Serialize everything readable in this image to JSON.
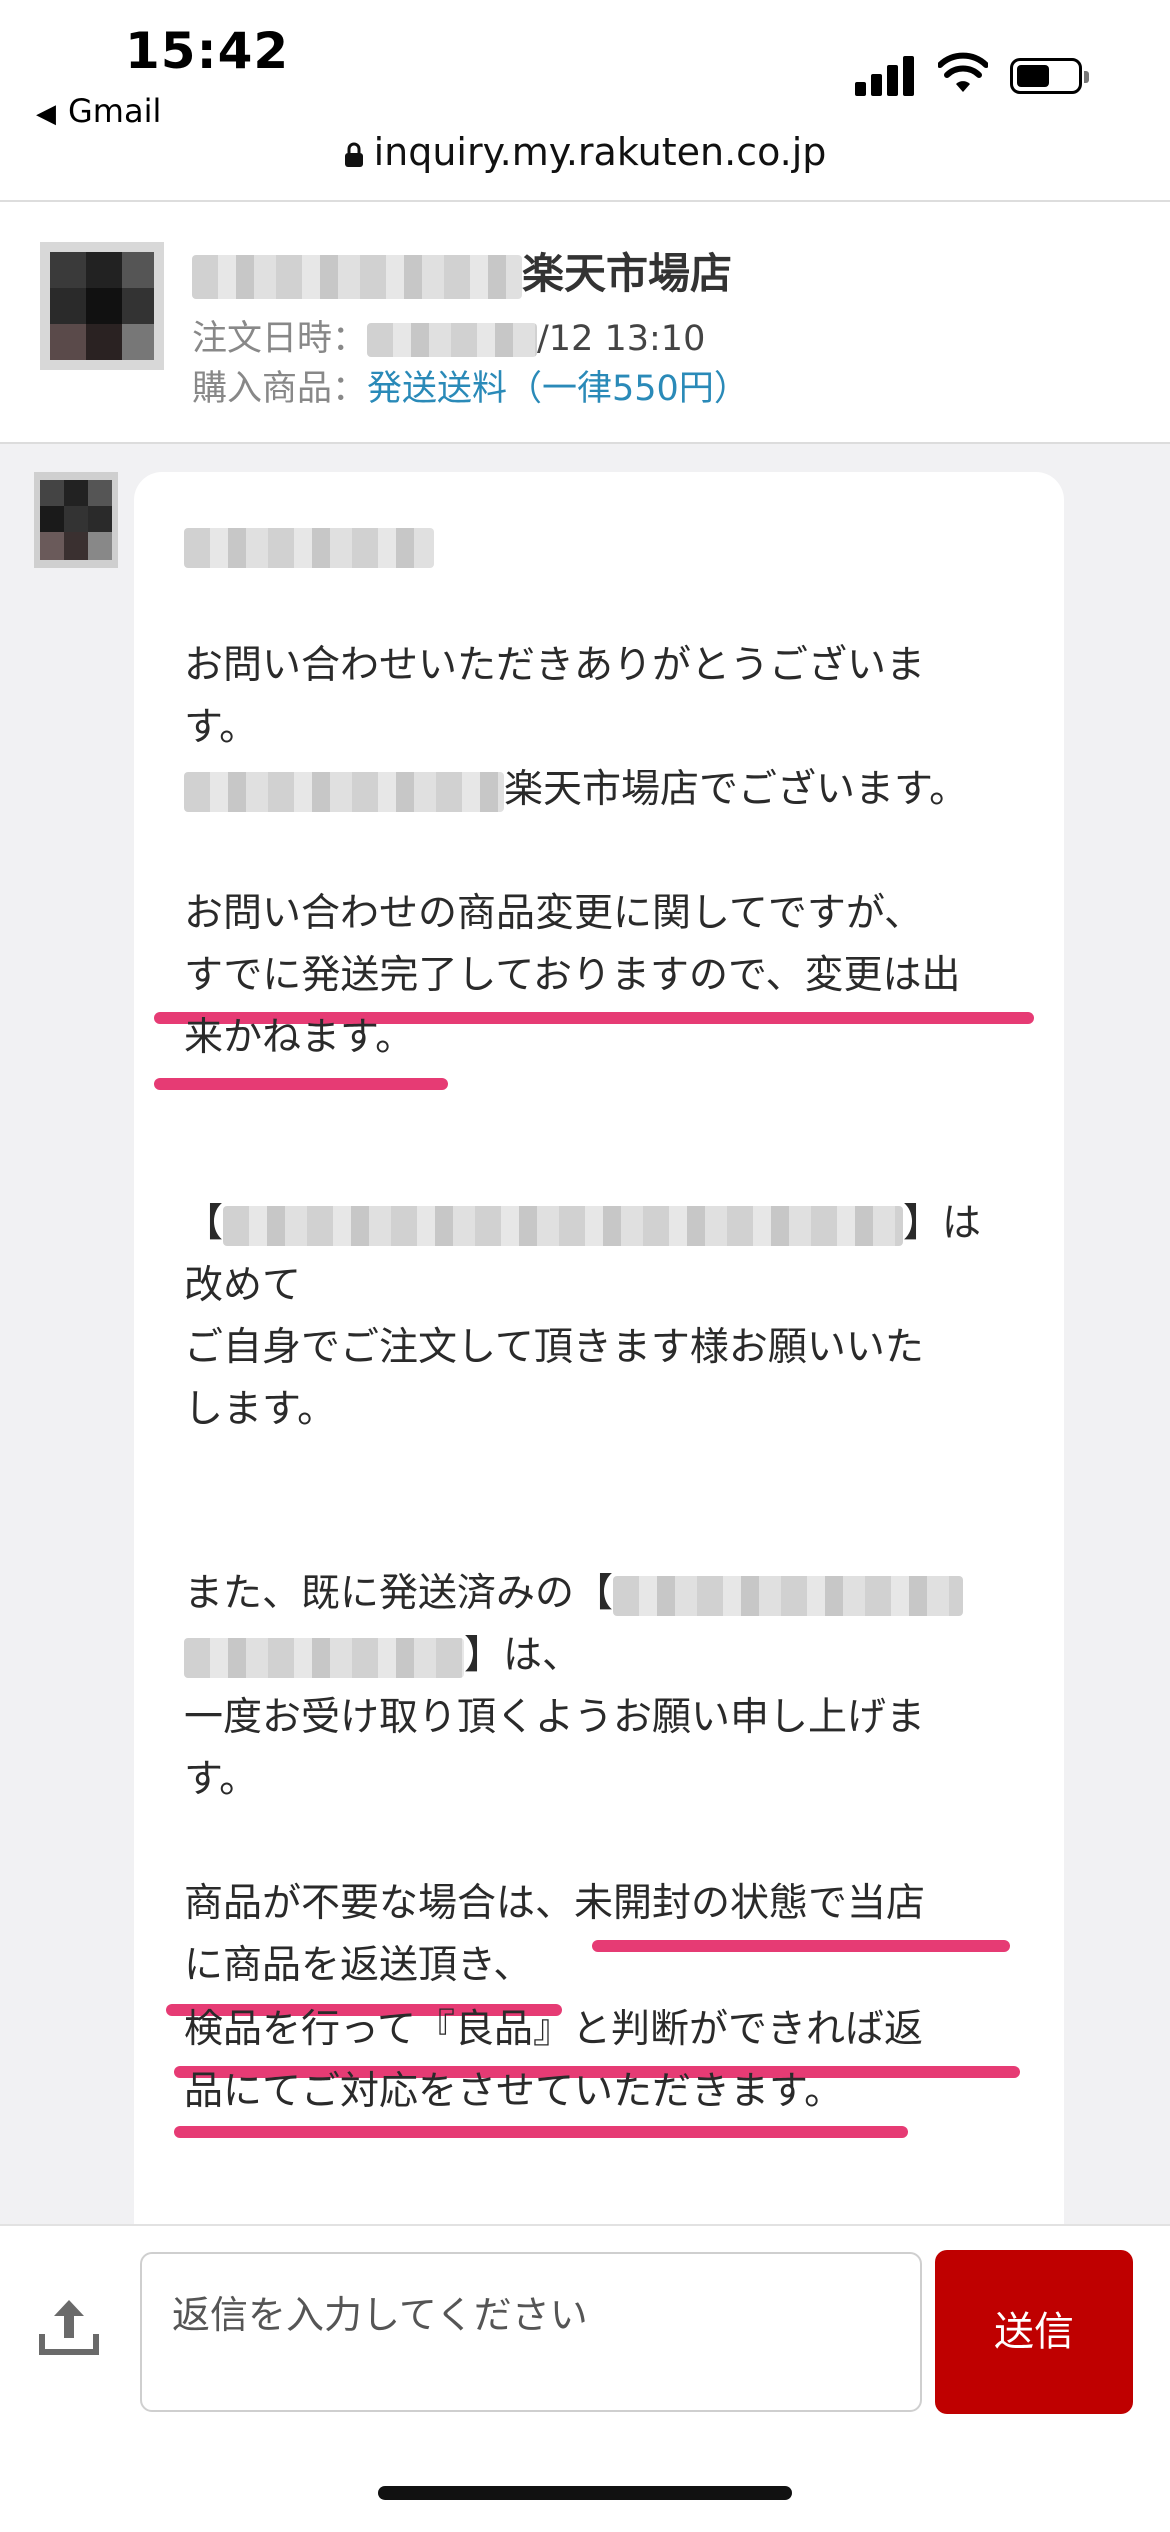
{
  "status_bar": {
    "time": "15:42",
    "back_app": "Gmail"
  },
  "browser": {
    "url": "inquiry.my.rakuten.co.jp"
  },
  "shop": {
    "name_suffix": "楽天市場店",
    "order_date_label": "注文日時：",
    "order_date_value": "/12 13:10",
    "product_label": "購入商品：",
    "product_value": "発送送料（一律550円）"
  },
  "message": {
    "line1": "お問い合わせいただきありがとうございま",
    "line2": "す。",
    "line3": "楽天市場店でございます。",
    "line4": "お問い合わせの商品変更に関してですが、",
    "line5": "すでに発送完了しておりますので、変更は出",
    "line6": "来かねます。",
    "line7_open": "【",
    "line7_close": "】は",
    "line8": "改めて",
    "line9": "ご自身でご注文して頂きます様お願いいた",
    "line10": "します。",
    "line11": "また、既に発送済みの【",
    "line12": "】は、",
    "line13": "一度お受け取り頂くようお願い申し上げま",
    "line14": "す。",
    "line15": "商品が不要な場合は、未開封の状態で当店",
    "line16": "に商品を返送頂き、",
    "line17": "検品を行って『良品』と判断ができれば返",
    "line18": "品にてご対応をさせていただきます。"
  },
  "reply": {
    "placeholder": "返信を入力してください",
    "send_label": "送信"
  },
  "colors": {
    "send_button": "#bf0000",
    "link": "#2a8ab8",
    "highlight": "#e63b74"
  }
}
